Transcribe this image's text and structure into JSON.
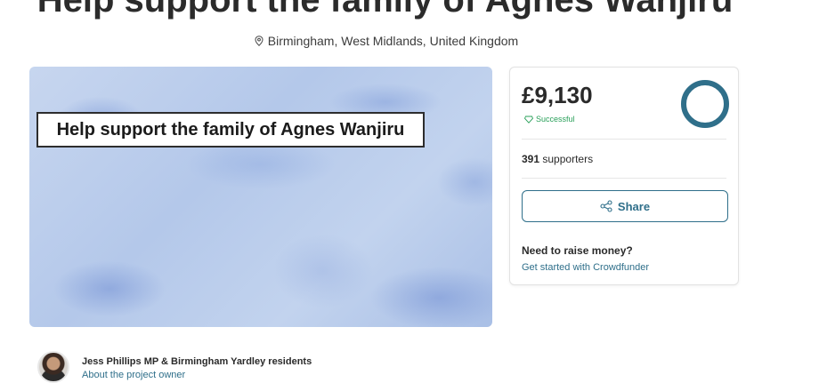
{
  "page": {
    "title": "Help support the family of Agnes Wanjiru",
    "location": "Birmingham, West Midlands, United Kingdom"
  },
  "hero": {
    "caption": "Help support the family of Agnes Wanjiru"
  },
  "funding": {
    "amount": "£9,130",
    "status": "Successful",
    "status_color": "#2aa05a",
    "progress_fraction": 1.0,
    "supporters_count": "391",
    "supporters_label": "supporters",
    "share_label": "Share",
    "raise_title": "Need to raise money?",
    "raise_link": "Get started with Crowdfunder",
    "accent_color": "#2f6f8a"
  },
  "owner": {
    "name": "Jess Phillips MP & Birmingham Yardley residents",
    "link": "About the project owner"
  },
  "icons": {
    "location": "map-pin-icon",
    "status": "badge-icon",
    "share": "share-icon",
    "progress": "progress-ring"
  }
}
